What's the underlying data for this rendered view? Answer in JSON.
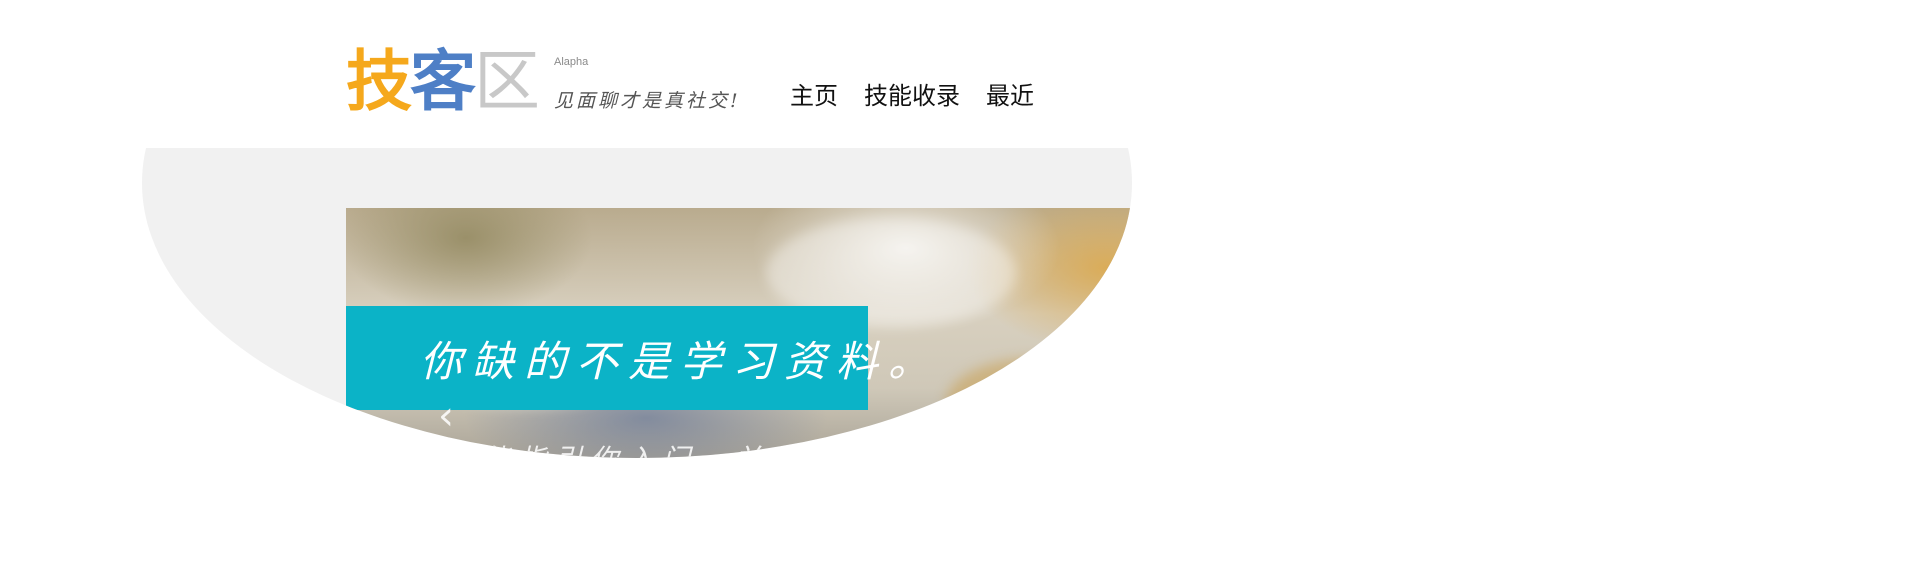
{
  "header": {
    "logo": {
      "chars": [
        "技",
        "客",
        "区"
      ],
      "badge": "Alapha",
      "slogan": "见面聊才是真社交!"
    },
    "nav": {
      "items": [
        "主页",
        "技能收录",
        "最近"
      ]
    }
  },
  "banner": {
    "title": "你缺的不是学习资料。",
    "subtitle": "是能指引你入门，并陪伴你",
    "prev_icon": "‹"
  },
  "colors": {
    "logo_yellow": "#f5a81c",
    "logo_blue": "#4e7fc6",
    "logo_grey": "#c8c8c8",
    "banner_cyan": "#0bb3c7",
    "band_grey": "#f1f1f1"
  }
}
